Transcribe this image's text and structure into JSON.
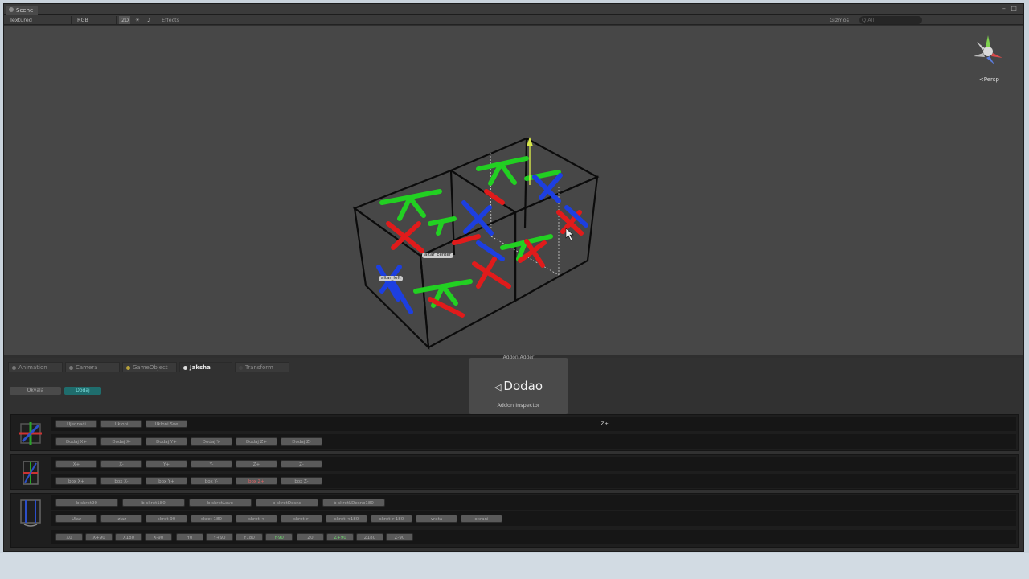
{
  "window": {
    "scene_tab": "Scene",
    "controls": "– □"
  },
  "toolbar": {
    "shading": "Textured",
    "render": "RGB",
    "mode_2d": "2D",
    "effects": "Effects",
    "gizmos": "Gizmos",
    "search_placeholder": "Q:All"
  },
  "viewport": {
    "persp_label": "<Persp",
    "label_center": "altar_center",
    "label_left": "altar_left"
  },
  "bottom_tabs": [
    {
      "label": "Animation",
      "active": false
    },
    {
      "label": "Camera",
      "active": false
    },
    {
      "label": "GameObject",
      "active": false
    },
    {
      "label": "Jaksha",
      "active": true
    },
    {
      "label": "Transform",
      "active": false
    }
  ],
  "subtabs": [
    {
      "label": "Okvala"
    },
    {
      "label": "Dodaj"
    }
  ],
  "overlay": {
    "top": "Addon Adder",
    "logo": "Dodao",
    "sub": "Addon Inspector"
  },
  "panel1": {
    "row1": [
      "Ujednači",
      "Ukloni",
      "Ukloni Sve"
    ],
    "row2": [
      "Dodaj X+",
      "Dodaj X-",
      "Dodaj Y+",
      "Dodaj Y-",
      "Dodaj Z+",
      "Dodaj Z-"
    ],
    "label": "Z+"
  },
  "panel2": {
    "row1": [
      "X+",
      "X-",
      "Y+",
      "Y-",
      "Z+",
      "Z-"
    ],
    "row2": [
      "box X+",
      "box X-",
      "box Y+",
      "box Y-",
      "box Z+",
      "box Z-"
    ]
  },
  "panel3": {
    "row1": [
      "b skret90",
      "b skret180",
      "b skretLevo",
      "b skretDesno",
      "b skretLDesno180"
    ],
    "row2": [
      "Ulaz",
      "Izlaz",
      "skret 90",
      "skret 180",
      "skret <",
      "skret >",
      "skret <180",
      "skret >180",
      "vrata",
      "okrani"
    ],
    "row3": [
      "X0",
      "X+90",
      "X180",
      "X-90",
      "Y0",
      "Y+90",
      "Y180",
      "Y-90",
      "Z0",
      "Z+90",
      "Z180",
      "Z-90"
    ]
  },
  "colors": {
    "axis_x": "#e01b1b",
    "axis_y": "#22d022",
    "axis_z": "#1d3fe0",
    "teal": "#1f6d6d"
  }
}
